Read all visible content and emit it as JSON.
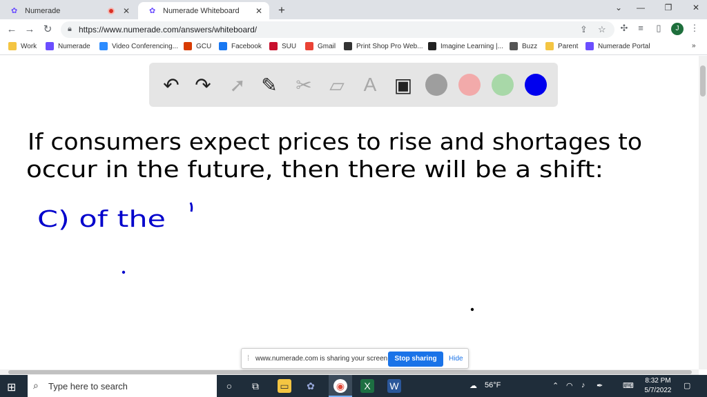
{
  "browser": {
    "tabs": [
      {
        "title": "Numerade",
        "active": false,
        "recording": true
      },
      {
        "title": "Numerade Whiteboard",
        "active": true,
        "recording": false
      }
    ],
    "url": "https://www.numerade.com/answers/whiteboard/",
    "profile_initial": "J",
    "bookmarks": [
      {
        "label": "Work",
        "icon": "folder-icon",
        "color": "#f4c542"
      },
      {
        "label": "Numerade",
        "icon": "numerade-icon",
        "color": "#6b4eff"
      },
      {
        "label": "Video Conferencing...",
        "icon": "video-icon",
        "color": "#2d8cff"
      },
      {
        "label": "GCU",
        "icon": "grid-icon",
        "color": "#d83b01"
      },
      {
        "label": "Facebook",
        "icon": "facebook-icon",
        "color": "#1877f2"
      },
      {
        "label": "SUU",
        "icon": "suu-icon",
        "color": "#c8102e"
      },
      {
        "label": "Gmail",
        "icon": "gmail-icon",
        "color": "#ea4335"
      },
      {
        "label": "Print Shop Pro Web...",
        "icon": "print-icon",
        "color": "#333333"
      },
      {
        "label": "Imagine Learning |...",
        "icon": "imagine-icon",
        "color": "#222222"
      },
      {
        "label": "Buzz",
        "icon": "buzz-icon",
        "color": "#555555"
      },
      {
        "label": "Parent",
        "icon": "folder-icon",
        "color": "#f4c542"
      },
      {
        "label": "Numerade Portal",
        "icon": "numerade-icon",
        "color": "#6b4eff"
      }
    ],
    "more_bookmarks": "»"
  },
  "whiteboard": {
    "toolbar": {
      "tools": [
        {
          "name": "undo-icon",
          "glyph": "↶"
        },
        {
          "name": "redo-icon",
          "glyph": "↷"
        },
        {
          "name": "select-pointer-icon",
          "glyph": "➚"
        },
        {
          "name": "pen-icon",
          "glyph": "✎"
        },
        {
          "name": "tools-icon",
          "glyph": "✂"
        },
        {
          "name": "eraser-icon",
          "glyph": "▱"
        },
        {
          "name": "text-icon",
          "glyph": "A"
        },
        {
          "name": "image-icon",
          "glyph": "▣"
        }
      ],
      "colors": [
        "#9e9e9e",
        "#f2aaaa",
        "#a8d8a8",
        "#0000ee"
      ]
    },
    "handwriting": {
      "line1": "If consumers expect prices to rise and shortages to",
      "line2": "occur in the future, then there will be a shift:",
      "line3": "C) of the"
    },
    "share_notice": {
      "message": "www.numerade.com is sharing your screen.",
      "stop_label": "Stop sharing",
      "hide_label": "Hide"
    }
  },
  "taskbar": {
    "search_placeholder": "Type here to search",
    "weather": "56°F",
    "time": "8:32 PM",
    "date": "5/7/2022"
  }
}
